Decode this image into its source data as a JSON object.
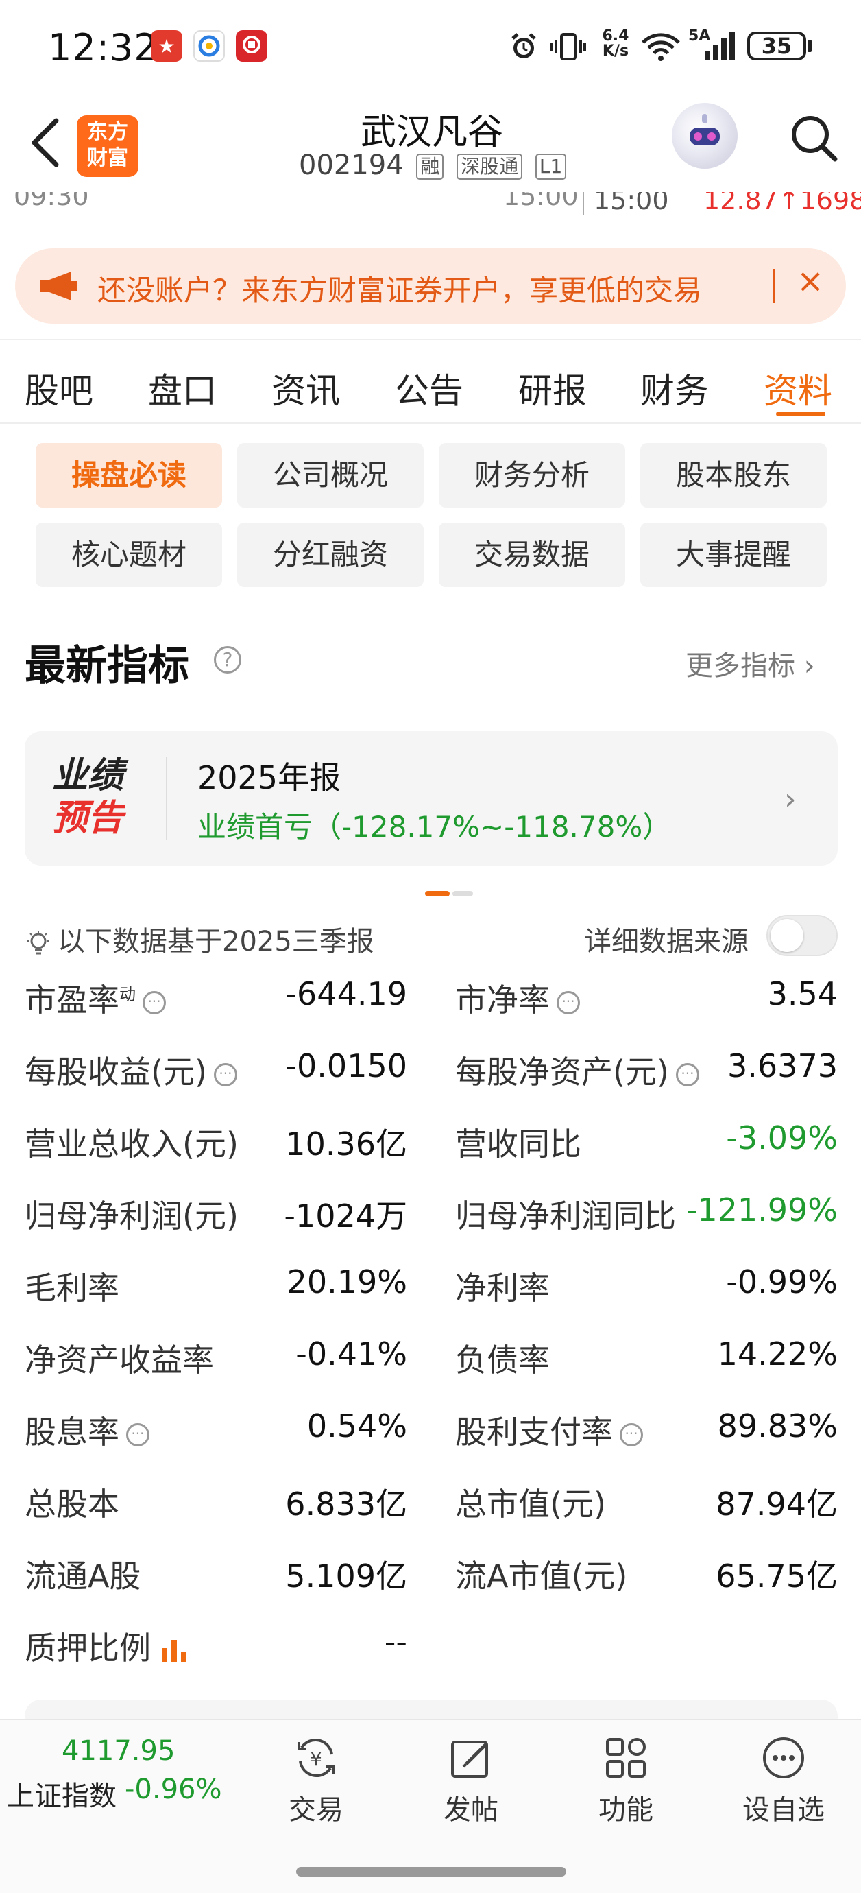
{
  "status_bar": {
    "time": "12:32",
    "net_speed_top": "6.4",
    "net_speed_bottom": "K/s",
    "net_type": "5A",
    "battery": "35"
  },
  "header": {
    "logo_line1": "东方",
    "logo_line2": "财富",
    "stock_name": "武汉凡谷",
    "stock_code": "002194",
    "tags": [
      "融",
      "深股通",
      "L1"
    ]
  },
  "price_strip": {
    "time_left": "09:30",
    "time_mid": "15:00",
    "time_right": "15:00",
    "price_text": "12.87↑1698"
  },
  "banner": {
    "text": "还没账户？来东方财富证券开户，享更低的交易",
    "close": "×"
  },
  "tabs": [
    "股吧",
    "盘口",
    "资讯",
    "公告",
    "研报",
    "财务",
    "资料"
  ],
  "active_tab": "资料",
  "sub_tabs": [
    "操盘必读",
    "公司概况",
    "财务分析",
    "股本股东",
    "核心题材",
    "分红融资",
    "交易数据",
    "大事提醒"
  ],
  "section": {
    "title": "最新指标",
    "help": "?",
    "more": "更多指标 ›"
  },
  "forecast": {
    "badge_line1": "业绩",
    "badge_line2": "预告",
    "title": "2025年报",
    "value": "业绩首亏（-128.17%~-118.78%）",
    "chevron": "›"
  },
  "basis": {
    "text": "以下数据基于2025三季报",
    "source_label": "详细数据来源",
    "source_toggle_on": false
  },
  "metrics": [
    [
      {
        "label": "市盈率",
        "sup": "动",
        "info": true,
        "value": "-644.19"
      },
      {
        "label": "市净率",
        "info": true,
        "value": "3.54"
      }
    ],
    [
      {
        "label": "每股收益(元)",
        "info": true,
        "value": "-0.0150"
      },
      {
        "label": "每股净资产(元)",
        "info": true,
        "value": "3.6373"
      }
    ],
    [
      {
        "label": "营业总收入(元)",
        "value": "10.36亿"
      },
      {
        "label": "营收同比",
        "value": "-3.09%",
        "color": "green"
      }
    ],
    [
      {
        "label": "归母净利润(元)",
        "value": "-1024万"
      },
      {
        "label": "归母净利润同比",
        "value": "-121.99%",
        "color": "green"
      }
    ],
    [
      {
        "label": "毛利率",
        "value": "20.19%"
      },
      {
        "label": "净利率",
        "value": "-0.99%"
      }
    ],
    [
      {
        "label": "净资产收益率",
        "value": "-0.41%"
      },
      {
        "label": "负债率",
        "value": "14.22%"
      }
    ],
    [
      {
        "label": "股息率",
        "info": true,
        "value": "0.54%"
      },
      {
        "label": "股利支付率",
        "info": true,
        "value": "89.83%"
      }
    ],
    [
      {
        "label": "总股本",
        "value": "6.833亿"
      },
      {
        "label": "总市值(元)",
        "value": "87.94亿"
      }
    ],
    [
      {
        "label": "流通A股",
        "value": "5.109亿"
      },
      {
        "label": "流A市值(元)",
        "value": "65.75亿"
      }
    ],
    [
      {
        "label": "质押比例",
        "chart_icon": true,
        "value": "--"
      }
    ]
  ],
  "bottom_bar": {
    "index_value": "4117.95",
    "index_name": "上证指数",
    "index_change": "-0.96%",
    "items": [
      {
        "label": "交易",
        "icon": "trade-icon"
      },
      {
        "label": "发帖",
        "icon": "edit-icon"
      },
      {
        "label": "功能",
        "icon": "grid-icon"
      },
      {
        "label": "设自选",
        "icon": "more-icon"
      }
    ]
  },
  "colors": {
    "accent": "#f06a10",
    "down_green": "#1f9a2e",
    "up_red": "#e8302c"
  }
}
